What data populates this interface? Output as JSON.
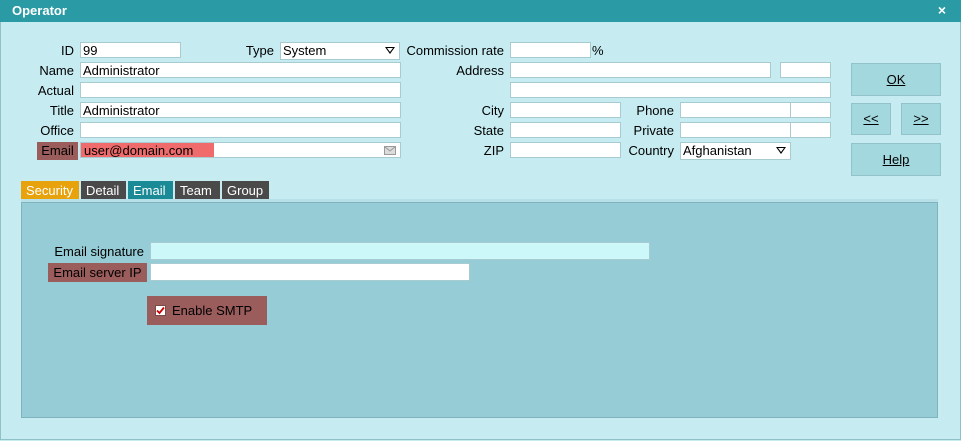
{
  "window": {
    "title": "Operator",
    "close_glyph": "×"
  },
  "fields": {
    "id": {
      "label": "ID",
      "value": "99"
    },
    "type": {
      "label": "Type",
      "value": "System"
    },
    "commission": {
      "label": "Commission rate",
      "value": "",
      "suffix": "%"
    },
    "name": {
      "label": "Name",
      "value": "Administrator"
    },
    "address": {
      "label": "Address",
      "value": "",
      "value2": "",
      "line2": ""
    },
    "actual": {
      "label": "Actual",
      "value": ""
    },
    "title": {
      "label": "Title",
      "value": "Administrator"
    },
    "city": {
      "label": "City",
      "value": ""
    },
    "phone": {
      "label": "Phone",
      "value": "",
      "ext": ""
    },
    "office": {
      "label": "Office",
      "value": ""
    },
    "state": {
      "label": "State",
      "value": ""
    },
    "private": {
      "label": "Private",
      "value": "",
      "ext": ""
    },
    "email": {
      "label": "Email",
      "value": "user@domain.com",
      "icon": "envelope-icon"
    },
    "zip": {
      "label": "ZIP",
      "value": ""
    },
    "country": {
      "label": "Country",
      "value": "Afghanistan"
    }
  },
  "buttons": {
    "ok": "OK",
    "prev": "<<",
    "next": ">>",
    "help": "Help"
  },
  "tabs": [
    {
      "label": "Security",
      "color": "#e8a20c"
    },
    {
      "label": "Detail",
      "color": "#4a4a4a"
    },
    {
      "label": "Email",
      "color": "#1a8a96"
    },
    {
      "label": "Team",
      "color": "#4a4a4a"
    },
    {
      "label": "Group",
      "color": "#4a4a4a"
    }
  ],
  "email_tab": {
    "signature_label": "Email signature",
    "signature_value": "",
    "server_ip_label": "Email server IP",
    "server_ip_value": "",
    "smtp_label": "Enable SMTP",
    "smtp_checked": true
  },
  "colors": {
    "required_label_bg": "#9b5c5c",
    "email_highlight": "#f06b6b",
    "titlebar": "#2a9aa4"
  }
}
